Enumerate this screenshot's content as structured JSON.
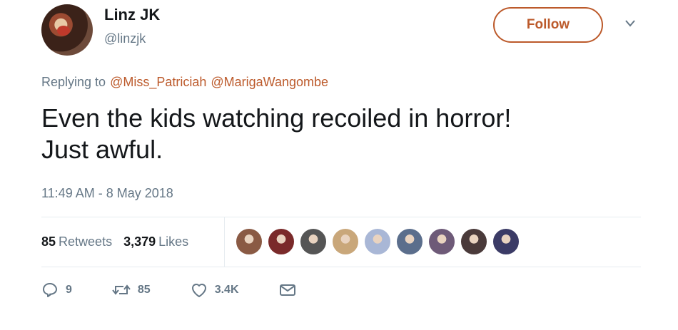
{
  "user": {
    "name": "Linz JK",
    "handle": "@linzjk"
  },
  "follow_label": "Follow",
  "reply": {
    "prefix": "Replying to",
    "mentions": [
      "@Miss_Patriciah",
      "@MarigaWangombe"
    ]
  },
  "tweet": {
    "lines": [
      "Even the kids watching recoiled in horror!",
      "Just awful."
    ]
  },
  "timestamp": "11:49 AM - 8 May 2018",
  "stats": {
    "retweets_count": "85",
    "retweets_label": "Retweets",
    "likes_count": "3,379",
    "likes_label": "Likes"
  },
  "actions": {
    "reply_count": "9",
    "retweet_count": "85",
    "like_count": "3.4K"
  },
  "colors": {
    "accent": "#bc5a2b",
    "muted": "#657786",
    "text": "#14171a"
  },
  "likers_avatar_colors": [
    "#8a5a44",
    "#7a2a2a",
    "#555555",
    "#c9a77a",
    "#a9b7d6",
    "#5b6e8c",
    "#6e5a78",
    "#4a3a3a",
    "#3b3b66"
  ]
}
